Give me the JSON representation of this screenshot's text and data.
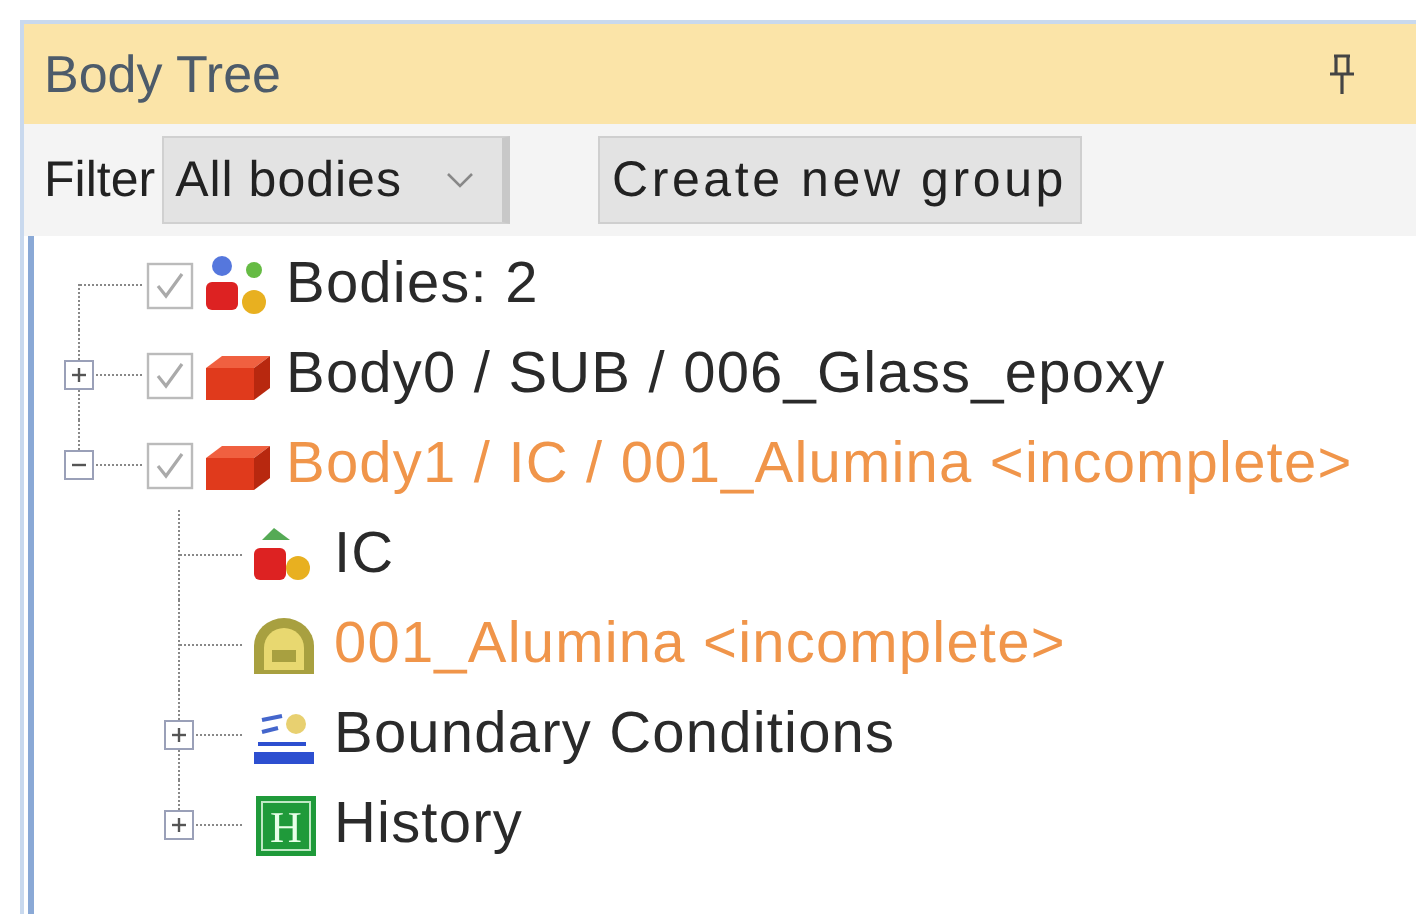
{
  "panel": {
    "title": "Body Tree"
  },
  "toolbar": {
    "filter_label": "Filter",
    "filter_value": "All bodies",
    "button": "Create new group"
  },
  "tree": [
    {
      "label": "Bodies: 2",
      "kind": "bodies",
      "checked": true,
      "incomplete": false
    },
    {
      "label": "Body0 / SUB / 006_Glass_epoxy",
      "kind": "body",
      "checked": true,
      "expanded": false,
      "incomplete": false
    },
    {
      "label": "Body1 / IC / 001_Alumina <incomplete>",
      "kind": "body",
      "checked": true,
      "expanded": true,
      "incomplete": true,
      "children": [
        {
          "label": "IC",
          "kind": "ic",
          "incomplete": false
        },
        {
          "label": "001_Alumina <incomplete>",
          "kind": "material",
          "incomplete": true
        },
        {
          "label": "Boundary Conditions",
          "kind": "boundary",
          "expanded": false,
          "incomplete": false
        },
        {
          "label": "History",
          "kind": "history",
          "badge": "H",
          "expanded": false,
          "incomplete": false
        }
      ]
    }
  ]
}
